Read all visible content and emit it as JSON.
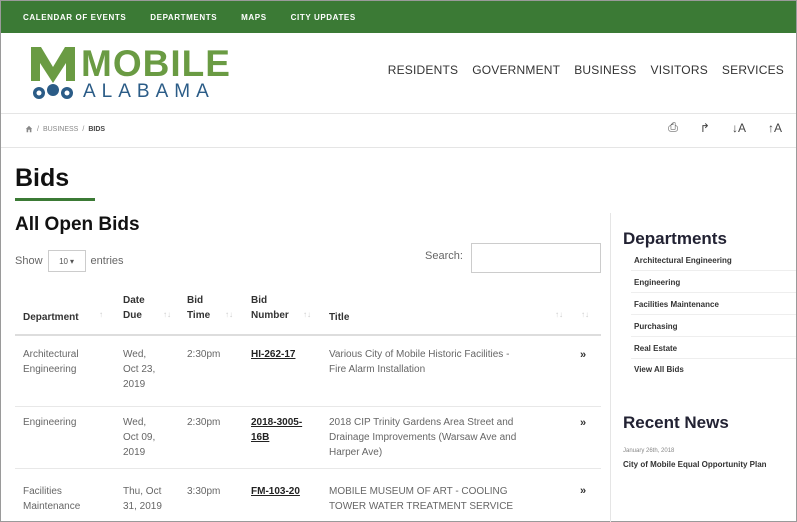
{
  "topbar": {
    "items": [
      "CALENDAR OF EVENTS",
      "DEPARTMENTS",
      "MAPS",
      "CITY UPDATES"
    ]
  },
  "logo": {
    "word": "MOBILE",
    "sub": "ALABAMA"
  },
  "nav": {
    "items": [
      "RESIDENTS",
      "GOVERNMENT",
      "BUSINESS",
      "VISITORS",
      "SERVICES"
    ]
  },
  "breadcrumb": {
    "sep": "/",
    "business": "BUSINESS",
    "current": "BIDS"
  },
  "tools": {
    "print": "⎙",
    "share": "↱",
    "decrease": "↓A",
    "increase": "↑A"
  },
  "page": {
    "title": "Bids",
    "section": "All Open Bids"
  },
  "table_controls": {
    "show": "Show",
    "entries_value": "10",
    "entries": "entries",
    "search": "Search:"
  },
  "table": {
    "headers": {
      "department": "Department",
      "date_line1": "Date",
      "date_line2": "Due",
      "time_line1": "Bid",
      "time_line2": "Time",
      "number_line1": "Bid",
      "number_line2": "Number",
      "title": "Title"
    },
    "rows": [
      {
        "department": [
          "Architectural",
          "Engineering"
        ],
        "date": [
          "Wed,",
          "Oct 23,",
          "2019"
        ],
        "time": "2:30pm",
        "number": [
          "HI-262-17"
        ],
        "title": [
          "Various City of Mobile Historic Facilities -",
          "Fire Alarm Installation"
        ],
        "action": "»"
      },
      {
        "department": [
          "Engineering"
        ],
        "date": [
          "Wed,",
          "Oct 09,",
          "2019"
        ],
        "time": "2:30pm",
        "number": [
          "2018-3005-",
          "16B"
        ],
        "title": [
          "2018 CIP Trinity Gardens Area Street and",
          "Drainage Improvements (Warsaw Ave and",
          "Harper Ave)"
        ],
        "action": "»"
      },
      {
        "department": [
          "Facilities",
          "Maintenance"
        ],
        "date": [
          "Thu, Oct",
          "31, 2019"
        ],
        "time": "3:30pm",
        "number": [
          "FM-103-20"
        ],
        "title": [
          "MOBILE MUSEUM OF ART - COOLING",
          "TOWER WATER TREATMENT SERVICE"
        ],
        "action": "»"
      }
    ]
  },
  "sidebar": {
    "departments_title": "Departments",
    "departments": [
      "Architectural Engineering",
      "Engineering",
      "Facilities Maintenance",
      "Purchasing",
      "Real Estate",
      "View All Bids"
    ],
    "news_title": "Recent News",
    "news_date": "January 26th, 2018",
    "news_item": "City of Mobile Equal Opportunity Plan"
  },
  "colors": {
    "brand_green": "#3b7a35",
    "logo_green": "#6a9b43",
    "logo_blue": "#2b5c87"
  }
}
